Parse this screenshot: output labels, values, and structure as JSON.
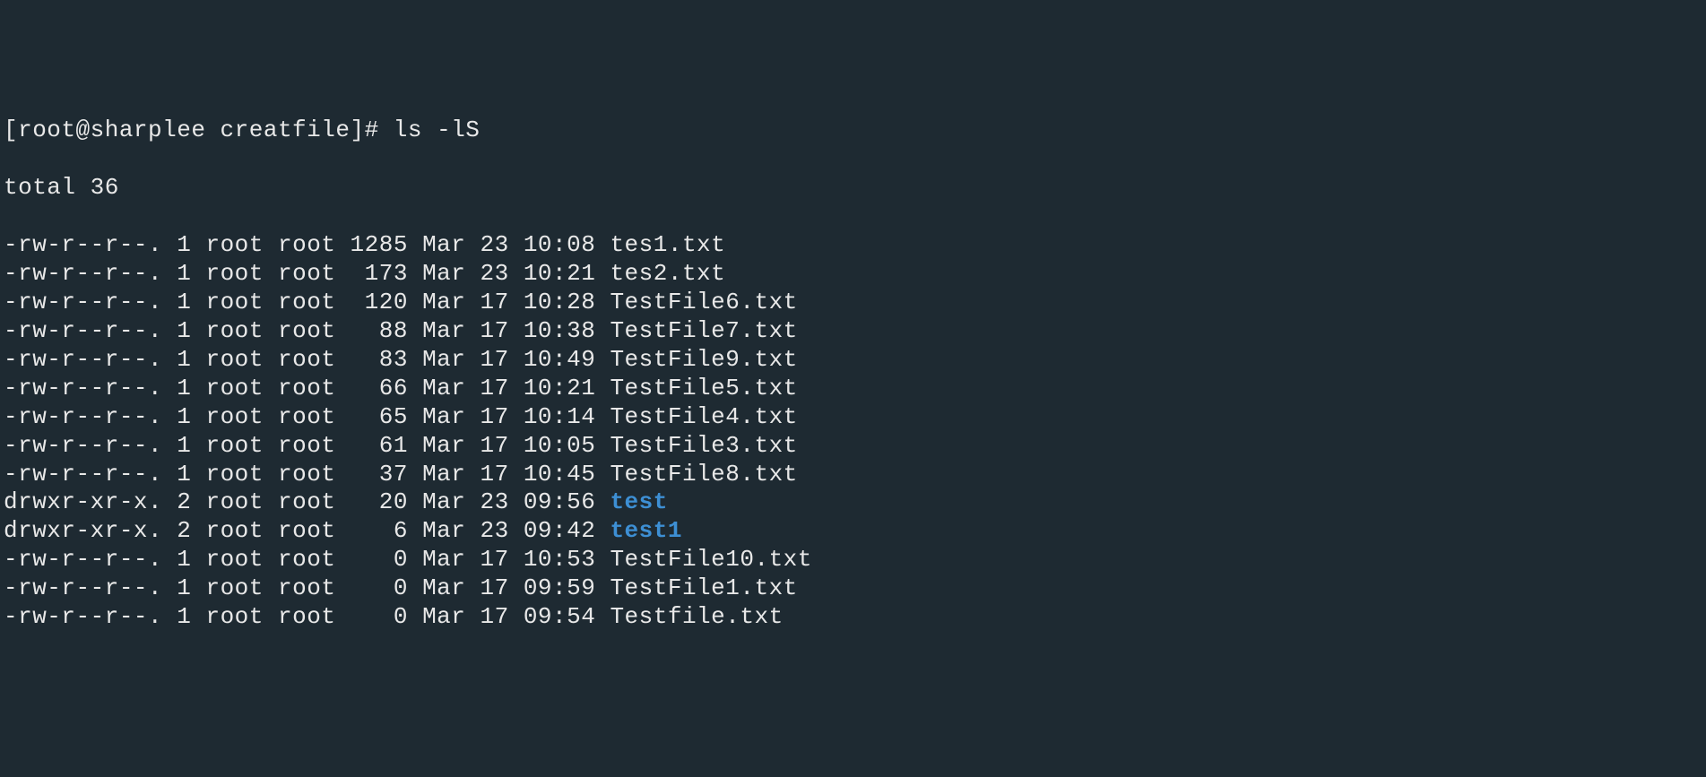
{
  "prompt": {
    "prefix": "[root@sharplee creatfile]# ",
    "command": "ls -lS"
  },
  "total_line": "total 36",
  "entries": [
    {
      "perms": "-rw-r--r--.",
      "links": "1",
      "owner": "root",
      "group": "root",
      "size": "1285",
      "month": "Mar",
      "day": "23",
      "time": "10:08",
      "name": "tes1.txt",
      "is_dir": false
    },
    {
      "perms": "-rw-r--r--.",
      "links": "1",
      "owner": "root",
      "group": "root",
      "size": " 173",
      "month": "Mar",
      "day": "23",
      "time": "10:21",
      "name": "tes2.txt",
      "is_dir": false
    },
    {
      "perms": "-rw-r--r--.",
      "links": "1",
      "owner": "root",
      "group": "root",
      "size": " 120",
      "month": "Mar",
      "day": "17",
      "time": "10:28",
      "name": "TestFile6.txt",
      "is_dir": false
    },
    {
      "perms": "-rw-r--r--.",
      "links": "1",
      "owner": "root",
      "group": "root",
      "size": "  88",
      "month": "Mar",
      "day": "17",
      "time": "10:38",
      "name": "TestFile7.txt",
      "is_dir": false
    },
    {
      "perms": "-rw-r--r--.",
      "links": "1",
      "owner": "root",
      "group": "root",
      "size": "  83",
      "month": "Mar",
      "day": "17",
      "time": "10:49",
      "name": "TestFile9.txt",
      "is_dir": false
    },
    {
      "perms": "-rw-r--r--.",
      "links": "1",
      "owner": "root",
      "group": "root",
      "size": "  66",
      "month": "Mar",
      "day": "17",
      "time": "10:21",
      "name": "TestFile5.txt",
      "is_dir": false
    },
    {
      "perms": "-rw-r--r--.",
      "links": "1",
      "owner": "root",
      "group": "root",
      "size": "  65",
      "month": "Mar",
      "day": "17",
      "time": "10:14",
      "name": "TestFile4.txt",
      "is_dir": false
    },
    {
      "perms": "-rw-r--r--.",
      "links": "1",
      "owner": "root",
      "group": "root",
      "size": "  61",
      "month": "Mar",
      "day": "17",
      "time": "10:05",
      "name": "TestFile3.txt",
      "is_dir": false
    },
    {
      "perms": "-rw-r--r--.",
      "links": "1",
      "owner": "root",
      "group": "root",
      "size": "  37",
      "month": "Mar",
      "day": "17",
      "time": "10:45",
      "name": "TestFile8.txt",
      "is_dir": false
    },
    {
      "perms": "drwxr-xr-x.",
      "links": "2",
      "owner": "root",
      "group": "root",
      "size": "  20",
      "month": "Mar",
      "day": "23",
      "time": "09:56",
      "name": "test",
      "is_dir": true
    },
    {
      "perms": "drwxr-xr-x.",
      "links": "2",
      "owner": "root",
      "group": "root",
      "size": "   6",
      "month": "Mar",
      "day": "23",
      "time": "09:42",
      "name": "test1",
      "is_dir": true
    },
    {
      "perms": "-rw-r--r--.",
      "links": "1",
      "owner": "root",
      "group": "root",
      "size": "   0",
      "month": "Mar",
      "day": "17",
      "time": "10:53",
      "name": "TestFile10.txt",
      "is_dir": false
    },
    {
      "perms": "-rw-r--r--.",
      "links": "1",
      "owner": "root",
      "group": "root",
      "size": "   0",
      "month": "Mar",
      "day": "17",
      "time": "09:59",
      "name": "TestFile1.txt",
      "is_dir": false
    },
    {
      "perms": "-rw-r--r--.",
      "links": "1",
      "owner": "root",
      "group": "root",
      "size": "   0",
      "month": "Mar",
      "day": "17",
      "time": "09:54",
      "name": "Testfile.txt",
      "is_dir": false
    }
  ]
}
